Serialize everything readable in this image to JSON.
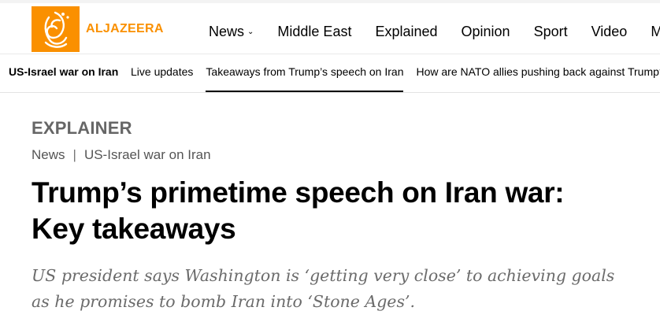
{
  "brand": {
    "name": "ALJAZEERA",
    "color": "#fa9000",
    "icon": "al-jazeera-logo-icon"
  },
  "nav": {
    "items": [
      {
        "label": "News",
        "dropdown": true
      },
      {
        "label": "Middle East"
      },
      {
        "label": "Explained"
      },
      {
        "label": "Opinion"
      },
      {
        "label": "Sport"
      },
      {
        "label": "Video"
      },
      {
        "label": "M"
      }
    ]
  },
  "subnav": {
    "tag": "US-Israel war on Iran",
    "links": [
      {
        "label": "Live updates",
        "active": false
      },
      {
        "label": "Takeaways from Trump’s speech on Iran",
        "active": true
      },
      {
        "label": "How are NATO allies pushing back against Trump?",
        "active": false
      }
    ]
  },
  "article": {
    "label": "EXPLAINER",
    "breadcrumb": [
      "News",
      "US-Israel war on Iran"
    ],
    "breadcrumb_separator": "|",
    "headline_line1": "Trump’s primetime speech on Iran war:",
    "headline_line2": "Key takeaways",
    "standfirst_line1": "US president says Washington is ‘getting very close’ to achieving goals",
    "standfirst_line2": "as he promises to bomb Iran into ‘Stone Ages’."
  }
}
